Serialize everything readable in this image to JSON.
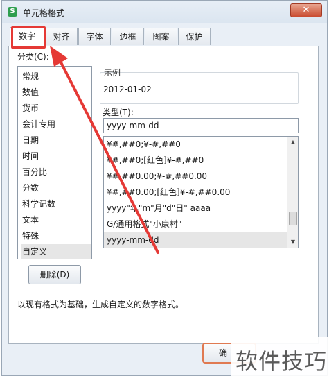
{
  "window": {
    "title": "单元格格式",
    "app_icon_letter": "S",
    "close_label": "✕"
  },
  "tabs": [
    {
      "label": "数字",
      "active": true
    },
    {
      "label": "对齐",
      "active": false
    },
    {
      "label": "字体",
      "active": false
    },
    {
      "label": "边框",
      "active": false
    },
    {
      "label": "图案",
      "active": false
    },
    {
      "label": "保护",
      "active": false
    }
  ],
  "category": {
    "label": "分类(C):",
    "items": [
      "常规",
      "数值",
      "货币",
      "会计专用",
      "日期",
      "时间",
      "百分比",
      "分数",
      "科学记数",
      "文本",
      "特殊",
      "自定义"
    ],
    "selected": "自定义"
  },
  "preview": {
    "label": "示例",
    "value": "2012-01-02"
  },
  "type": {
    "label": "类型(T):",
    "value": "yyyy-mm-dd",
    "formats": [
      "¥#,##0;¥-#,##0",
      "¥#,##0;[红色]¥-#,##0",
      "¥#,##0.00;¥-#,##0.00",
      "¥#,##0.00;[红色]¥-#,##0.00",
      "yyyy\"年\"m\"月\"d\"日\" aaaa",
      "G/通用格式\"小康村\"",
      "yyyy-mm-dd"
    ],
    "selected_format": "yyyy-mm-dd"
  },
  "delete_button": {
    "label": "删除(D)"
  },
  "description": "以现有格式为基础，生成自定义的数字格式。",
  "ok_button": {
    "label": "确"
  },
  "watermark": {
    "text": "软件技巧"
  },
  "annotation": {
    "highlight_color": "#e53935",
    "arrow_color": "#e53935"
  }
}
